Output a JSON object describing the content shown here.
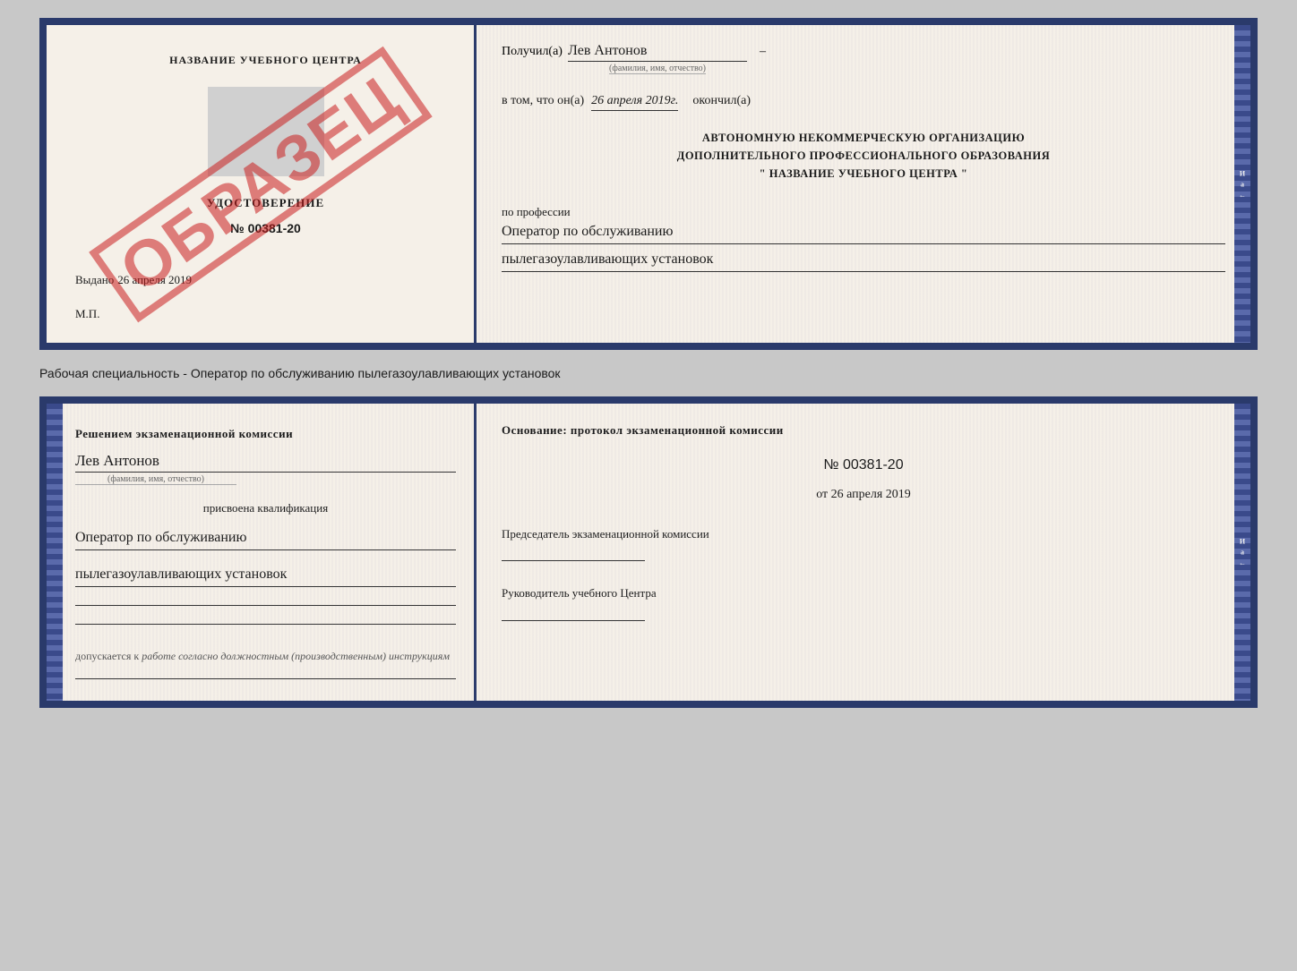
{
  "page": {
    "background_color": "#c8c8c8"
  },
  "top_section": {
    "left": {
      "center_title": "НАЗВАНИЕ УЧЕБНОГО ЦЕНТРА",
      "cert_label": "УДОСТОВЕРЕНИЕ",
      "cert_number": "№ 00381-20",
      "issued_prefix": "Выдано",
      "issued_date": "26 апреля 2019",
      "mp_label": "М.П.",
      "watermark": "ОБРАЗЕЦ"
    },
    "right": {
      "recipient_prefix": "Получил(а)",
      "recipient_name": "Лев Антонов",
      "fio_label": "(фамилия, имя, отчество)",
      "date_prefix": "в том, что он(а)",
      "date_value": "26 апреля 2019г.",
      "completed_label": "окончил(а)",
      "org_line1": "АВТОНОМНУЮ НЕКОММЕРЧЕСКУЮ ОРГАНИЗАЦИЮ",
      "org_line2": "ДОПОЛНИТЕЛЬНОГО ПРОФЕССИОНАЛЬНОГО ОБРАЗОВАНИЯ",
      "org_line3": "\" НАЗВАНИЕ УЧЕБНОГО ЦЕНТРА \"",
      "profession_label": "по профессии",
      "profession_line1": "Оператор по обслуживанию",
      "profession_line2": "пылегазоулавливающих установок"
    }
  },
  "between_text": "Рабочая специальность - Оператор по обслуживанию пылегазоулавливающих установок",
  "bottom_section": {
    "left": {
      "decision_text": "Решением экзаменационной комиссии",
      "person_name": "Лев Антонов",
      "fio_label": "(фамилия, имя, отчество)",
      "assigned_text": "присвоена квалификация",
      "qualification_line1": "Оператор по обслуживанию",
      "qualification_line2": "пылегазоулавливающих установок",
      "allowed_text": "допускается к",
      "allowed_italic": "работе согласно должностным (производственным) инструкциям"
    },
    "right": {
      "osnov_text": "Основание: протокол экзаменационной комиссии",
      "protocol_number": "№ 00381-20",
      "protocol_date_prefix": "от",
      "protocol_date": "26 апреля 2019",
      "chairman_label": "Председатель экзаменационной комиссии",
      "head_label": "Руководитель учебного Центра"
    }
  }
}
